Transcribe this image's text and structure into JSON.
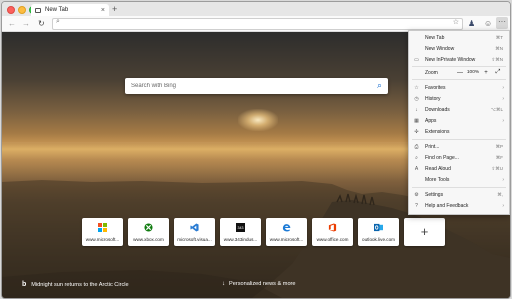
{
  "tab": {
    "title": "New Tab",
    "close": "×"
  },
  "toolbar": {
    "back": "←",
    "forward": "→",
    "refresh": "↻",
    "address_value": "",
    "star": "☆",
    "emoji": "☺",
    "more": "···",
    "reading_icon": "♟"
  },
  "search": {
    "placeholder": "Search with Bing",
    "icon": "⌕"
  },
  "top_sites": [
    {
      "label": "www.microsoft...",
      "icon": "microsoft-logo-icon"
    },
    {
      "label": "www.xbox.com",
      "icon": "xbox-icon"
    },
    {
      "label": "microsoft.visua...",
      "icon": "visual-studio-icon"
    },
    {
      "label": "www.343indus...",
      "icon": "halo-343-icon"
    },
    {
      "label": "www.microsoft...",
      "icon": "edge-icon"
    },
    {
      "label": "www.office.com",
      "icon": "office-icon"
    },
    {
      "label": "outlook.live.com",
      "icon": "outlook-icon"
    }
  ],
  "add_tile": "+",
  "caption": {
    "text": "Midnight sun returns to the Arctic Circle",
    "logo": "b"
  },
  "personalized": {
    "text": "Personalized news & more",
    "arrow": "↓"
  },
  "menu": {
    "new_tab": {
      "label": "New Tab",
      "shortcut": "⌘T"
    },
    "new_window": {
      "label": "New Window",
      "shortcut": "⌘N"
    },
    "new_inprivate": {
      "label": "New InPrivate Window",
      "shortcut": "⇧⌘N"
    },
    "zoom": {
      "label": "Zoom",
      "minus": "—",
      "value": "100%",
      "plus": "+",
      "fullscreen": "⤢"
    },
    "favorites": {
      "label": "Favorites"
    },
    "history": {
      "label": "History"
    },
    "downloads": {
      "label": "Downloads",
      "shortcut": "⌥⌘L"
    },
    "apps": {
      "label": "Apps"
    },
    "extensions": {
      "label": "Extensions"
    },
    "print": {
      "label": "Print...",
      "shortcut": "⌘P"
    },
    "find": {
      "label": "Find on Page...",
      "shortcut": "⌘F"
    },
    "read_aloud": {
      "label": "Read Aloud",
      "shortcut": "⇧⌘U"
    },
    "more_tools": {
      "label": "More Tools"
    },
    "settings": {
      "label": "Settings",
      "shortcut": "⌘,"
    },
    "help": {
      "label": "Help and Feedback"
    }
  }
}
